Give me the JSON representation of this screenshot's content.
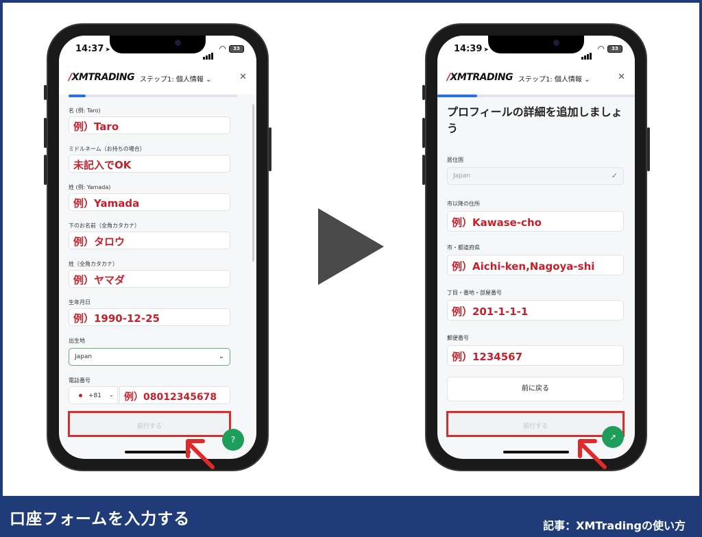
{
  "banner": {
    "title": "口座フォームを入力する",
    "credit": "記事：XMTradingの使い方"
  },
  "left_phone": {
    "time": "14:37",
    "battery": "33",
    "logo": "XMTRADING",
    "step": "ステップ1: 個人情報",
    "progress": 0.1,
    "fields": [
      {
        "label": "名 (例: Taro)",
        "value": "例）Taro"
      },
      {
        "label": "ミドルネーム（お持ちの場合）",
        "value": "未記入でOK"
      },
      {
        "label": "姓 (例: Yamada)",
        "value": "例）Yamada"
      },
      {
        "label": "下のお名前（全角カタカナ）",
        "value": "例）タロウ"
      },
      {
        "label": "姓（全角カタカナ）",
        "value": "例）ヤマダ"
      },
      {
        "label": "生年月日",
        "value": "例）1990-12-25"
      }
    ],
    "birthplace_label": "出生地",
    "birthplace_value": "Japan",
    "phone_label": "電話番号",
    "phone_code": "+81",
    "phone_value": "例）08012345678",
    "proceed_label": "前行する"
  },
  "right_phone": {
    "time": "14:39",
    "battery": "33",
    "logo": "XMTRADING",
    "step": "ステップ1: 個人情報",
    "progress": 0.2,
    "heading": "プロフィールの詳細を追加しましょう",
    "country_label": "居住国",
    "country_value": "Japan",
    "fields": [
      {
        "label": "市以降の住所",
        "value": "例）Kawase-cho"
      },
      {
        "label": "市・都道府県",
        "value": "例）Aichi-ken,Nagoya-shi"
      },
      {
        "label": "丁目・番地・部屋番号",
        "value": "例）201-1-1-1"
      },
      {
        "label": "郵便番号",
        "value": "例）1234567"
      }
    ],
    "back_label": "前に戻る",
    "proceed_label": "前行する"
  },
  "icons": {
    "close": "close-icon",
    "chevron": "chevron-down-icon",
    "check": "check-icon",
    "help": "help-chat-icon",
    "next": "play-arrow-icon",
    "pointer": "red-pointer-arrow-icon"
  },
  "colors": {
    "brand_navy": "#1f3c78",
    "accent_red": "#c8202a",
    "progress_blue": "#2c6fe0",
    "help_green": "#1e9e5a"
  }
}
